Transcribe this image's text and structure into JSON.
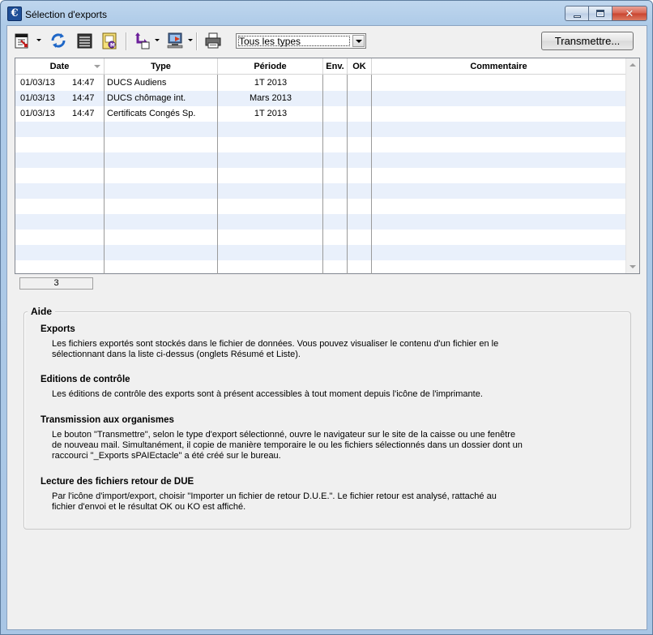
{
  "window": {
    "title": "Sélection d'exports",
    "app_icon_letter": "€"
  },
  "toolbar": {
    "icons": [
      "export-doc-icon",
      "refresh-icon",
      "list-icon",
      "certificate-icon",
      "import-export-icon",
      "send-computer-icon",
      "printer-icon"
    ],
    "type_filter": {
      "value": "Tous les types"
    },
    "transmit_label": "Transmettre..."
  },
  "grid": {
    "columns": [
      {
        "label": "Date"
      },
      {
        "label": "Type"
      },
      {
        "label": "Période"
      },
      {
        "label": "Env."
      },
      {
        "label": "OK"
      },
      {
        "label": "Commentaire"
      }
    ],
    "rows": [
      {
        "date": "01/03/13",
        "time": "14:47",
        "type": "DUCS Audiens",
        "periode": "1T 2013",
        "env": "",
        "ok": "",
        "commentaire": ""
      },
      {
        "date": "01/03/13",
        "time": "14:47",
        "type": "DUCS chômage int.",
        "periode": "Mars 2013",
        "env": "",
        "ok": "",
        "commentaire": ""
      },
      {
        "date": "01/03/13",
        "time": "14:47",
        "type": "Certificats Congés Sp.",
        "periode": "1T 2013",
        "env": "",
        "ok": "",
        "commentaire": ""
      }
    ],
    "count": "3"
  },
  "help": {
    "title": "Aide",
    "sections": [
      {
        "title": "Exports",
        "lines": [
          "Les fichiers exportés sont stockés dans le fichier de données. Vous pouvez visualiser le contenu d'un fichier en le",
          "sélectionnant dans la liste ci-dessus (onglets Résumé et Liste)."
        ]
      },
      {
        "title": "Editions de contrôle",
        "lines": [
          "Les éditions de contrôle des exports sont à présent accessibles à tout moment depuis l'icône de l'imprimante."
        ]
      },
      {
        "title": "Transmission aux organismes",
        "lines": [
          "Le bouton \"Transmettre\", selon le type d'export sélectionné, ouvre le navigateur sur le site de la caisse ou une fenêtre",
          "de nouveau mail. Simultanément, il copie de manière temporaire le ou les fichiers sélectionnés dans un dossier dont un",
          "raccourci \"_Exports sPAIEctacle\" a été créé sur le bureau."
        ]
      },
      {
        "title": "Lecture des fichiers retour de DUE",
        "lines": [
          "Par l'icône d'import/export, choisir \"Importer un fichier de retour D.U.E.\". Le fichier retour est analysé, rattaché au",
          "fichier d'envoi et le résultat OK ou KO est affiché."
        ]
      }
    ]
  }
}
